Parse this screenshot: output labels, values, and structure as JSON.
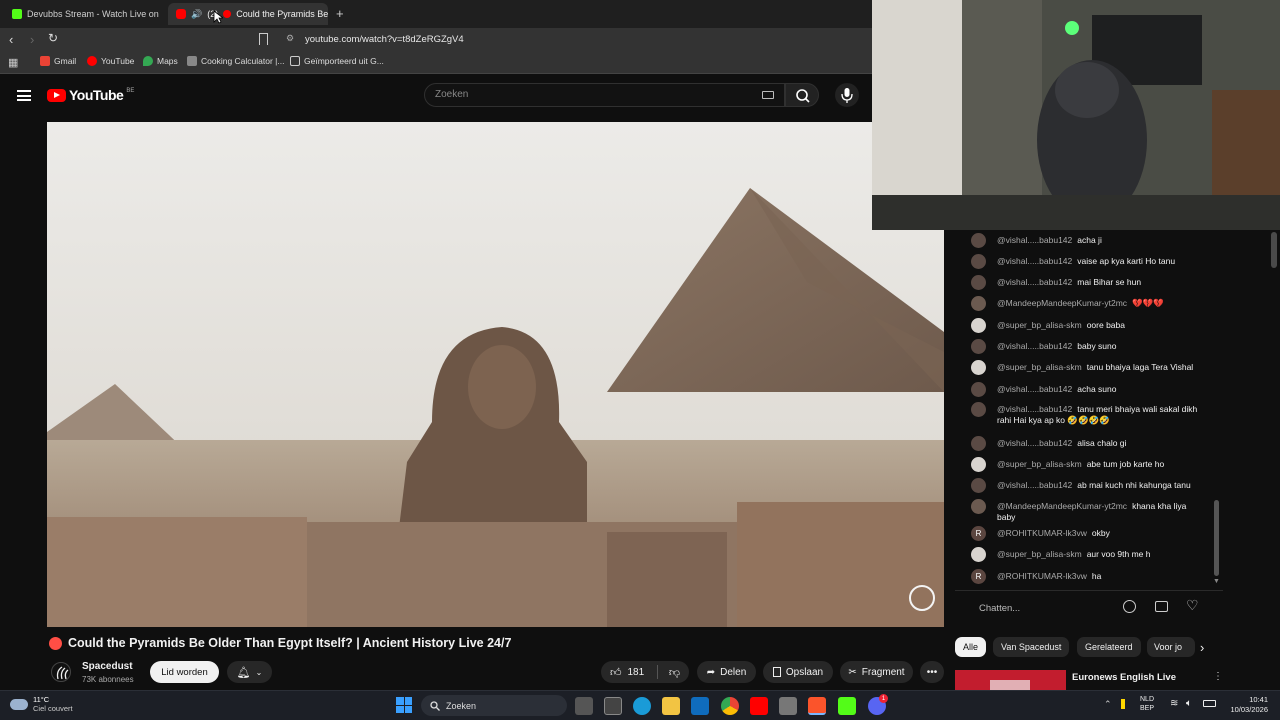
{
  "browser": {
    "tabs": [
      {
        "label": "Devubbs Stream - Watch Live on",
        "active": false
      },
      {
        "label": "(2)",
        "active": true
      },
      {
        "label": "Could the Pyramids Be",
        "active": true
      }
    ],
    "new_tab": "+",
    "close": "×",
    "url": "youtube.com/watch?v=t8dZeRGZgV4",
    "bookmarks": [
      "Gmail",
      "YouTube",
      "Maps",
      "Cooking Calculator |...",
      "Geïmporteerd uit G..."
    ]
  },
  "youtube": {
    "logo_text": "YouTube",
    "country": "BE",
    "search_placeholder": "Zoeken",
    "video_title": "Could the Pyramids Be Older Than Egypt Itself? | Ancient History Live 24/7",
    "channel_name": "Spacedust",
    "subscribers": "73K abonnees",
    "join_label": "Lid worden",
    "likes": "181",
    "share_label": "Delen",
    "save_label": "Opslaan",
    "clip_label": "Fragment",
    "chips": [
      "Alle",
      "Van Spacedust",
      "Gerelateerd",
      "Voor jo"
    ],
    "next_video_title": "Euronews English Live",
    "chat_placeholder": "Chatten..."
  },
  "chat": {
    "messages": [
      {
        "author": "@vishal.....babu142",
        "text": "acha ji",
        "avatar": "",
        "color": "#5a4a44"
      },
      {
        "author": "@vishal.....babu142",
        "text": "vaise ap kya karti Ho tanu",
        "avatar": "",
        "color": "#5a4a44"
      },
      {
        "author": "@vishal.....babu142",
        "text": "mai Bihar se hun",
        "avatar": "",
        "color": "#5a4a44"
      },
      {
        "author": "@MandeepMandeepKumar-yt2mc",
        "text": "💔💔💔",
        "avatar": "",
        "color": "#6b5a50"
      },
      {
        "author": "@super_bp_alisa-skm",
        "text": "oore baba",
        "avatar": "",
        "color": "#d8d4cf"
      },
      {
        "author": "@vishal.....babu142",
        "text": "baby suno",
        "avatar": "",
        "color": "#5a4a44"
      },
      {
        "author": "@super_bp_alisa-skm",
        "text": "tanu bhaiya laga Tera Vishal",
        "avatar": "",
        "color": "#d8d4cf"
      },
      {
        "author": "@vishal.....babu142",
        "text": "acha suno",
        "avatar": "",
        "color": "#5a4a44"
      },
      {
        "author": "@vishal.....babu142",
        "text": "tanu meri bhaiya wali sakal dikh rahi Hai kya ap ko 🤣🤣🤣🤣",
        "avatar": "",
        "color": "#5a4a44"
      },
      {
        "author": "@vishal.....babu142",
        "text": "alisa chalo gi",
        "avatar": "",
        "color": "#5a4a44"
      },
      {
        "author": "@super_bp_alisa-skm",
        "text": "abe tum job karte ho",
        "avatar": "",
        "color": "#d8d4cf"
      },
      {
        "author": "@vishal.....babu142",
        "text": "ab mai kuch nhi kahunga tanu",
        "avatar": "",
        "color": "#5a4a44"
      },
      {
        "author": "@MandeepMandeepKumar-yt2mc",
        "text": "khana kha liya baby",
        "avatar": "",
        "color": "#6b5a50"
      },
      {
        "author": "@ROHITKUMAR-lk3vw",
        "text": "okby",
        "avatar": "R",
        "color": "#5b4640"
      },
      {
        "author": "@super_bp_alisa-skm",
        "text": "aur voo 9th me h",
        "avatar": "",
        "color": "#d8d4cf"
      },
      {
        "author": "@ROHITKUMAR-lk3vw",
        "text": "ha",
        "avatar": "R",
        "color": "#5b4640"
      }
    ]
  },
  "taskbar": {
    "weather_temp": "11°C",
    "weather_desc": "Ciel couvert",
    "search_label": "Zoeken",
    "lang": "NLD",
    "lang2": "BEP",
    "time": "10:41",
    "date": "10/03/2026",
    "discord_badge": "1"
  }
}
